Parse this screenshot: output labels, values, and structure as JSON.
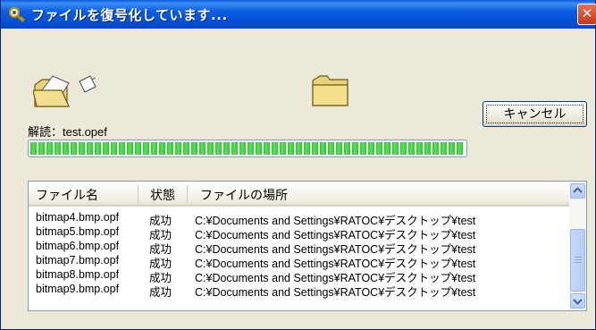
{
  "window": {
    "title": "ファイルを復号化しています...",
    "close_glyph": "✕"
  },
  "status": {
    "label": "解読：test.opef"
  },
  "cancel_button": {
    "label": "キャンセル"
  },
  "progress": {
    "fraction": 1.0
  },
  "colors": {
    "titlebar": "#0a5ee0",
    "progress": "#2fc52f",
    "window_bg": "#ece9d8"
  },
  "file_list": {
    "columns": [
      "ファイル名",
      "状態",
      "ファイルの場所"
    ],
    "rows": [
      {
        "name": "bitmap4.bmp.opf",
        "state": "成功",
        "location": "C:¥Documents and Settings¥RATOC¥デスクトップ¥test"
      },
      {
        "name": "bitmap5.bmp.opf",
        "state": "成功",
        "location": "C:¥Documents and Settings¥RATOC¥デスクトップ¥test"
      },
      {
        "name": "bitmap6.bmp.opf",
        "state": "成功",
        "location": "C:¥Documents and Settings¥RATOC¥デスクトップ¥test"
      },
      {
        "name": "bitmap7.bmp.opf",
        "state": "成功",
        "location": "C:¥Documents and Settings¥RATOC¥デスクトップ¥test"
      },
      {
        "name": "bitmap8.bmp.opf",
        "state": "成功",
        "location": "C:¥Documents and Settings¥RATOC¥デスクトップ¥test"
      },
      {
        "name": "bitmap9.bmp.opf",
        "state": "成功",
        "location": "C:¥Documents and Settings¥RATOC¥デスクトップ¥test"
      }
    ]
  },
  "icons": [
    "key-search-icon",
    "open-folder-icon",
    "flying-document-icon",
    "closed-folder-icon",
    "scroll-up-icon",
    "scroll-down-icon"
  ]
}
